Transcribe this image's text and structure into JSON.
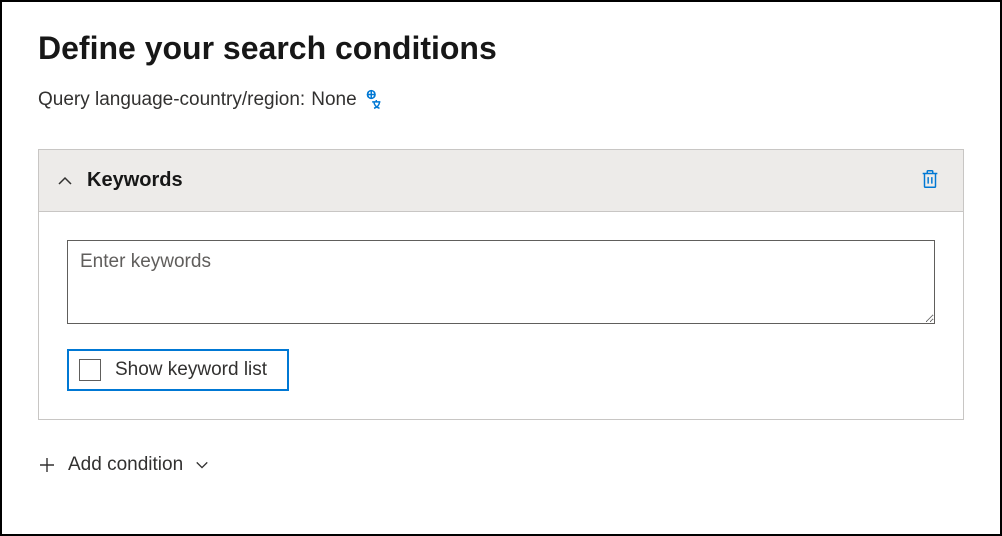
{
  "page_title": "Define your search conditions",
  "query_language_label": "Query language-country/region:",
  "query_language_value": "None",
  "keywords_panel": {
    "title": "Keywords",
    "input_placeholder": "Enter keywords",
    "input_value": "",
    "show_list_label": "Show keyword list",
    "show_list_checked": false
  },
  "add_condition_label": "Add condition"
}
